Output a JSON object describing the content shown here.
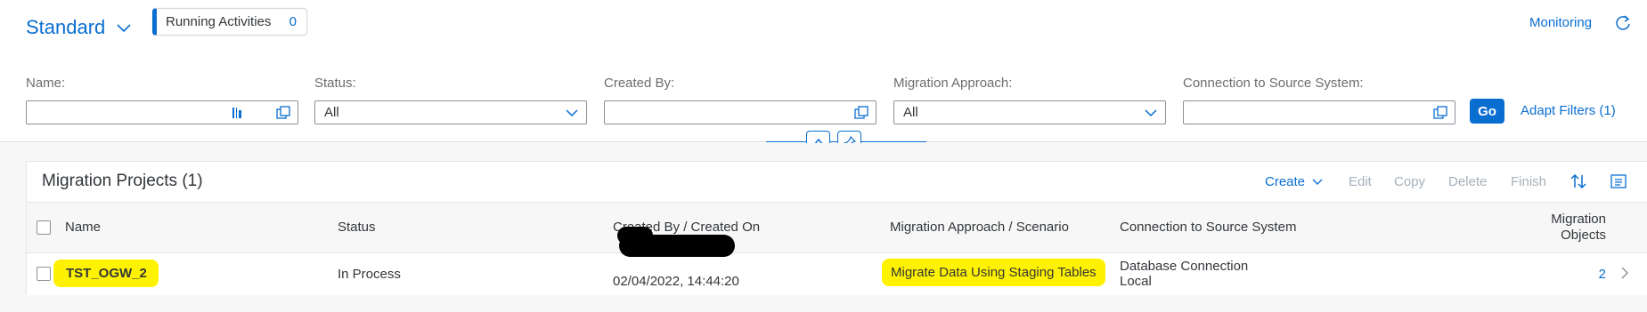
{
  "header": {
    "variant_title": "Standard",
    "running_activities_label": "Running Activities",
    "running_activities_count": "0",
    "monitoring_label": "Monitoring"
  },
  "filters": [
    {
      "label": "Name:",
      "value": ""
    },
    {
      "label": "Status:",
      "value": "All"
    },
    {
      "label": "Created By:",
      "value": ""
    },
    {
      "label": "Migration Approach:",
      "value": "All"
    },
    {
      "label": "Connection to Source System:",
      "value": ""
    }
  ],
  "go_label": "Go",
  "adapt_filters_label": "Adapt Filters (1)",
  "table": {
    "title": "Migration Projects (1)",
    "toolbar": {
      "create": "Create",
      "edit": "Edit",
      "copy": "Copy",
      "delete": "Delete",
      "finish": "Finish"
    },
    "columns": [
      "Name",
      "Status",
      "Created By / Created On",
      "Migration Approach / Scenario",
      "Connection to Source System",
      "Migration",
      "Objects"
    ],
    "rows": [
      {
        "name": "TST_OGW_2",
        "status": "In Process",
        "created_on": "02/04/2022, 14:44:20",
        "approach": "Migrate Data Using Staging Tables",
        "connection_line1": "Database Connection",
        "connection_line2": "Local",
        "objects": "2"
      }
    ]
  },
  "colors": {
    "accent": "#0a6ed1",
    "highlight": "#fff200",
    "disabled": "#a6b0bb"
  }
}
